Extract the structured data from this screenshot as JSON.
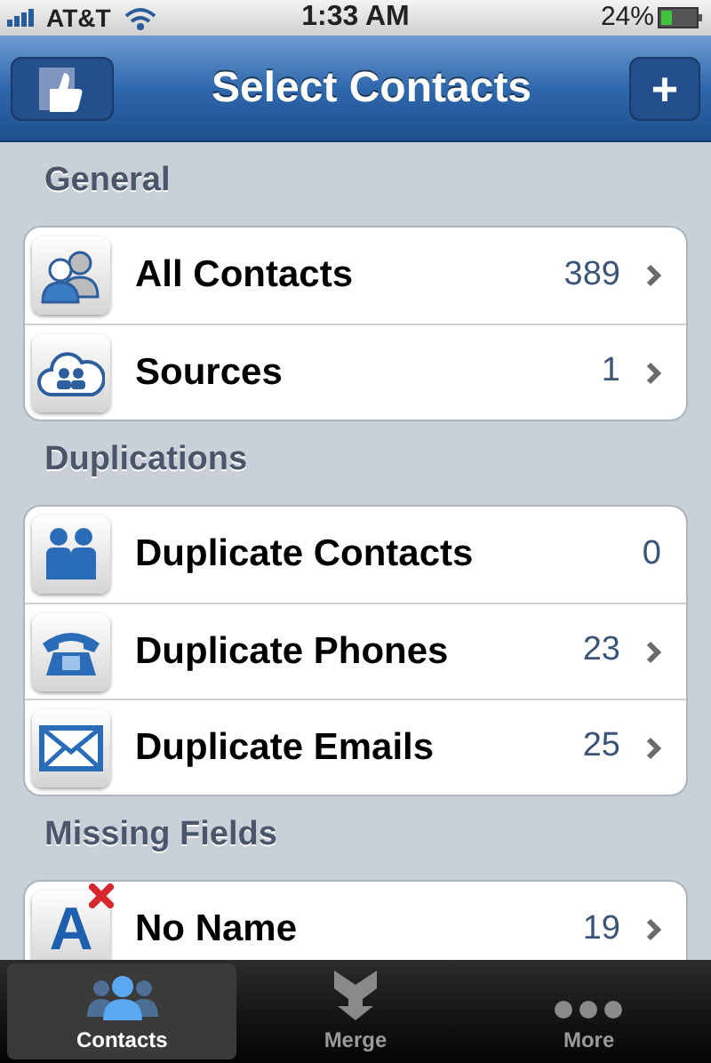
{
  "status_bar": {
    "carrier": "AT&T",
    "time": "1:33 AM",
    "battery": "24%"
  },
  "nav": {
    "title": "Select Contacts",
    "right_button": "+"
  },
  "sections": [
    {
      "title": "General",
      "rows": [
        {
          "kind": "people",
          "label": "All Contacts",
          "count": "389",
          "chevron": true
        },
        {
          "kind": "cloud",
          "label": "Sources",
          "count": "1",
          "chevron": true
        }
      ]
    },
    {
      "title": "Duplications",
      "rows": [
        {
          "kind": "pair",
          "label": "Duplicate Contacts",
          "count": "0",
          "chevron": false
        },
        {
          "kind": "phone",
          "label": "Duplicate Phones",
          "count": "23",
          "chevron": true
        },
        {
          "kind": "mail",
          "label": "Duplicate Emails",
          "count": "25",
          "chevron": true
        }
      ]
    },
    {
      "title": "Missing Fields",
      "rows": [
        {
          "kind": "letter",
          "icon_letter": "A",
          "label": "No Name",
          "count": "19",
          "chevron": true
        }
      ]
    }
  ],
  "tabs": [
    {
      "kind": "people",
      "label": "Contacts",
      "selected": true
    },
    {
      "kind": "merge",
      "label": "Merge",
      "selected": false
    },
    {
      "kind": "dots",
      "label": "More",
      "selected": false
    }
  ]
}
